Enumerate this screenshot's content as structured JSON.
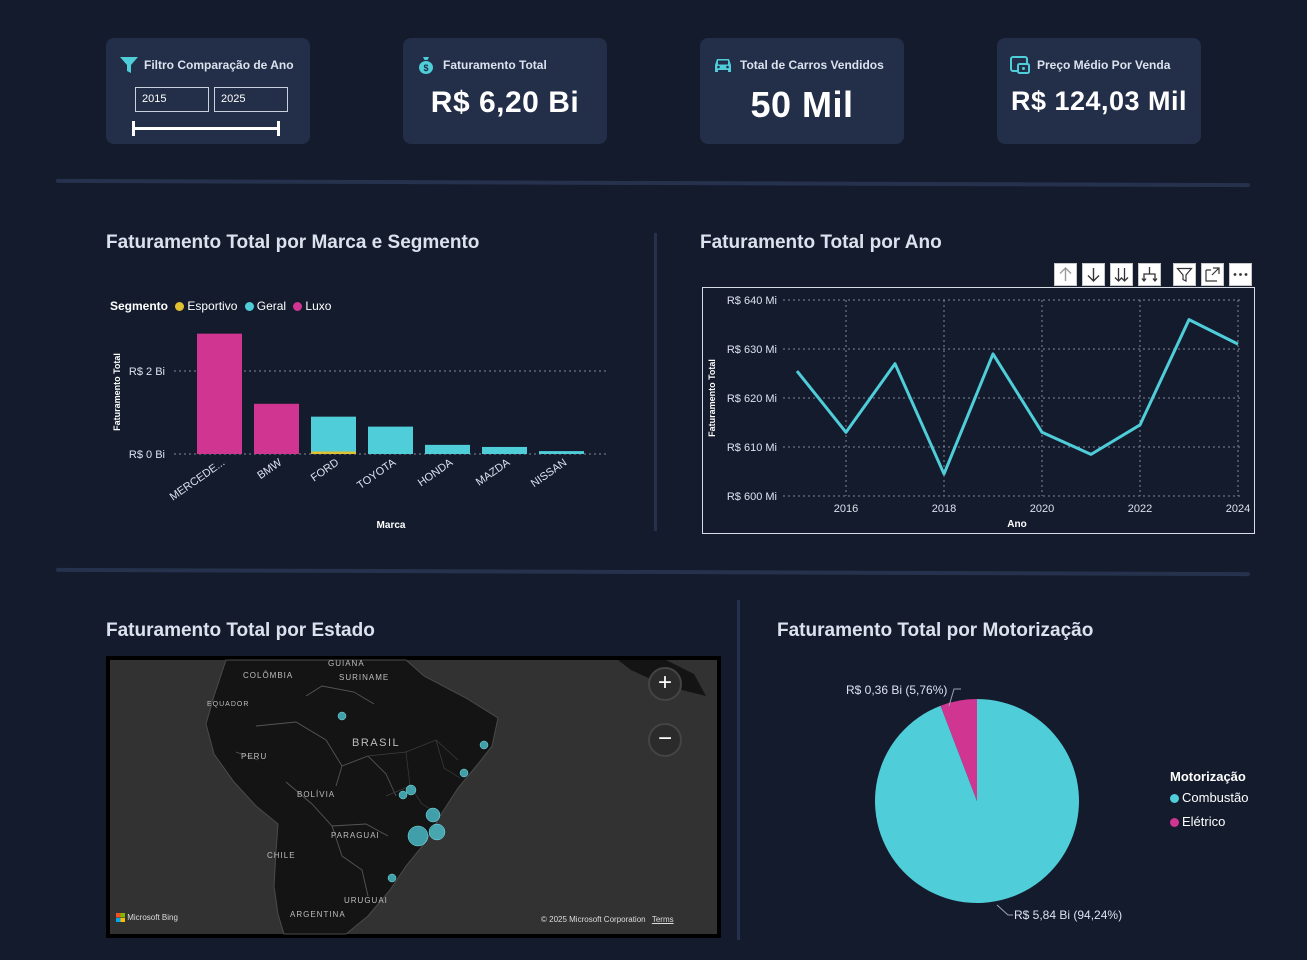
{
  "kpis": {
    "filter": {
      "title": "Filtro Comparação de Ano",
      "year_start": "2015",
      "year_end": "2025",
      "icon": "funnel-icon"
    },
    "revenue": {
      "title": "Faturamento Total",
      "value": "R$ 6,20 Bi",
      "icon": "money-bag-icon"
    },
    "cars": {
      "title": "Total de Carros Vendidos",
      "value": "50 Mil",
      "icon": "car-icon"
    },
    "avg_price": {
      "title": "Preço Médio Por Venda",
      "value": "R$ 124,03 Mil",
      "icon": "price-tag-icon"
    }
  },
  "bar_section": {
    "title": "Faturamento Total por Marca e Segmento",
    "legend_title": "Segmento",
    "legend": [
      "Esportivo",
      "Geral",
      "Luxo"
    ]
  },
  "line_section": {
    "title": "Faturamento Total por Ano",
    "toolbar": [
      "arrow-up-icon",
      "arrow-down-icon",
      "double-arrow-down-icon",
      "expand-hierarchy-icon",
      "filter-icon",
      "focus-mode-icon",
      "more-options-icon"
    ]
  },
  "map_section": {
    "title": "Faturamento Total por Estado",
    "labels": {
      "guiana": "GUIANA",
      "colombia": "COLÔMBIA",
      "suriname": "SURINAME",
      "equador": "EQUADOR",
      "brasil": "BRASIL",
      "peru": "PERU",
      "bolivia": "BOLÍVIA",
      "paraguai": "PARAGUAI",
      "chile": "CHILE",
      "uruguai": "URUGUAI",
      "argentina": "ARGENTINA"
    },
    "attribution": "Microsoft Bing",
    "copyright": "© 2025 Microsoft Corporation",
    "terms": "Terms"
  },
  "pie_section": {
    "title": "Faturamento Total por Motorização",
    "legend_title": "Motorização",
    "legend": [
      "Combustão",
      "Elétrico"
    ],
    "label_electric": "R$ 0,36 Bi (5,76%)",
    "label_combustion": "R$ 5,84 Bi (94,24%)"
  },
  "colors": {
    "esportivo": "#e0c132",
    "geral": "#4fcdd9",
    "luxo": "#d03591",
    "background": "#141b2d",
    "card": "#232e48"
  },
  "chart_data": [
    {
      "type": "bar",
      "title": "Faturamento Total por Marca e Segmento",
      "xlabel": "Marca",
      "ylabel": "Faturamento Total",
      "ytick_labels": [
        "R$ 0 Bi",
        "R$ 2 Bi"
      ],
      "ylim": [
        0,
        3.0
      ],
      "legend_title": "Segmento",
      "legend_position": "top-left",
      "grid": true,
      "categories": [
        "MERCEDE...",
        "BMW",
        "FORD",
        "TOYOTA",
        "HONDA",
        "MAZDA",
        "NISSAN"
      ],
      "series": [
        {
          "name": "Esportivo",
          "values": [
            0,
            0,
            0.06,
            0,
            0,
            0,
            0
          ]
        },
        {
          "name": "Geral",
          "values": [
            0,
            0,
            0.84,
            0.66,
            0.22,
            0.17,
            0.07
          ]
        },
        {
          "name": "Luxo",
          "values": [
            2.9,
            1.21,
            0,
            0,
            0,
            0,
            0
          ]
        }
      ]
    },
    {
      "type": "line",
      "title": "Faturamento Total por Ano",
      "xlabel": "Ano",
      "ylabel": "Faturamento Total",
      "x": [
        2015,
        2016,
        2017,
        2018,
        2019,
        2020,
        2021,
        2022,
        2023,
        2024
      ],
      "xtick_labels": [
        "2016",
        "2018",
        "2020",
        "2022",
        "2024"
      ],
      "ytick_labels": [
        "R$ 600 Mi",
        "R$ 610 Mi",
        "R$ 620 Mi",
        "R$ 630 Mi",
        "R$ 640 Mi"
      ],
      "ylim": [
        600,
        640
      ],
      "grid": true,
      "series": [
        {
          "values": [
            625.5,
            613,
            627,
            604.5,
            629,
            613,
            608.5,
            614.5,
            636,
            631
          ]
        }
      ]
    },
    {
      "type": "pie",
      "title": "Faturamento Total por Motorização",
      "legend_title": "Motorização",
      "legend_position": "right",
      "categories": [
        "Combustão",
        "Elétrico"
      ],
      "values": [
        5.84,
        0.36
      ],
      "percentages": [
        94.24,
        5.76
      ]
    }
  ]
}
